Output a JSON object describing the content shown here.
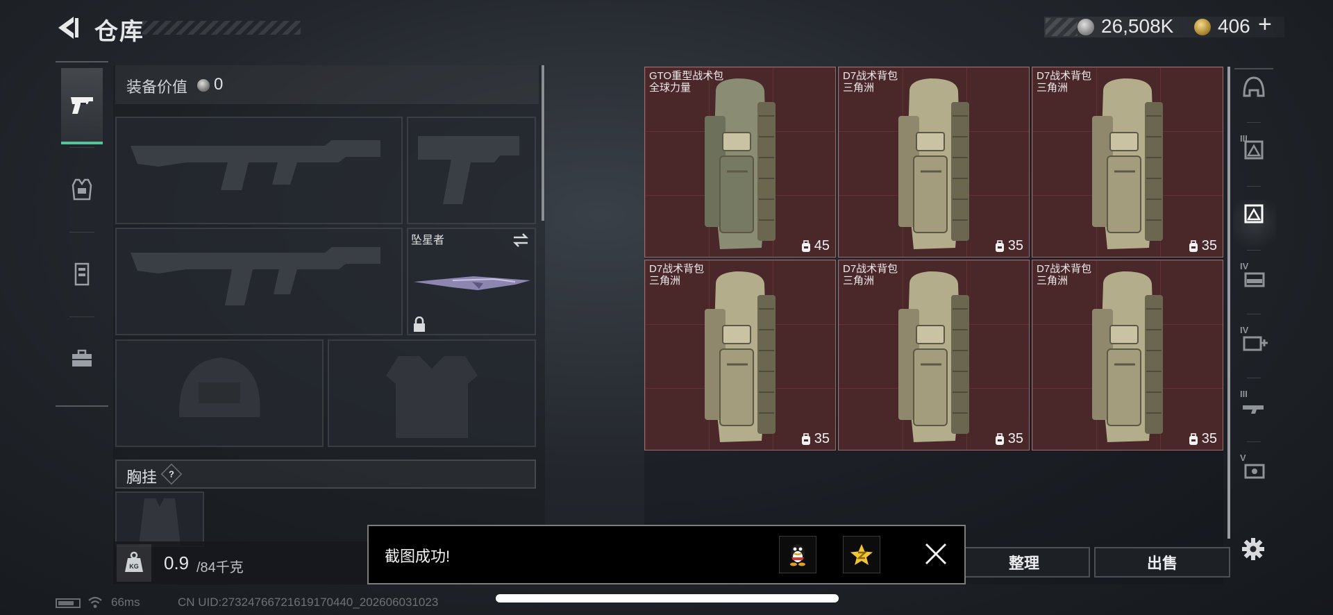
{
  "header": {
    "title": "仓库",
    "currency": {
      "silver": "26,508K",
      "gold": "406",
      "add": "+"
    }
  },
  "loadout": {
    "equipment_value_label": "装备价值",
    "equipment_value": "0",
    "melee_name": "坠星者",
    "chest_rig_label": "胸挂",
    "chest_rig_help": "?",
    "weight_current": "0.9",
    "weight_max": "/84千克"
  },
  "stash": {
    "items": [
      {
        "name": "GTO重型战术包",
        "source": "全球力量",
        "capacity": "45"
      },
      {
        "name": "D7战术背包",
        "source": "三角洲",
        "capacity": "35"
      },
      {
        "name": "D7战术背包",
        "source": "三角洲",
        "capacity": "35"
      },
      {
        "name": "D7战术背包",
        "source": "三角洲",
        "capacity": "35"
      },
      {
        "name": "D7战术背包",
        "source": "三角洲",
        "capacity": "35"
      },
      {
        "name": "D7战术背包",
        "source": "三角洲",
        "capacity": "35"
      }
    ],
    "item_color": "#4a2729",
    "sort_label": "整理",
    "sell_label": "出售"
  },
  "right_tabs": {
    "labels": [
      "",
      "III",
      "",
      "IV",
      "IV",
      "III",
      "V"
    ]
  },
  "toast": {
    "message": "截图成功!"
  },
  "status": {
    "ping": "66ms",
    "uid": "CN UID:2732476672161917044​0_202606031023"
  },
  "icons": {
    "back": "back-arrow-icon",
    "silver": "silver-coin-icon",
    "gold": "gold-coin-icon",
    "settings": "gear-icon",
    "close": "close-icon",
    "accent": "#56c39a"
  }
}
